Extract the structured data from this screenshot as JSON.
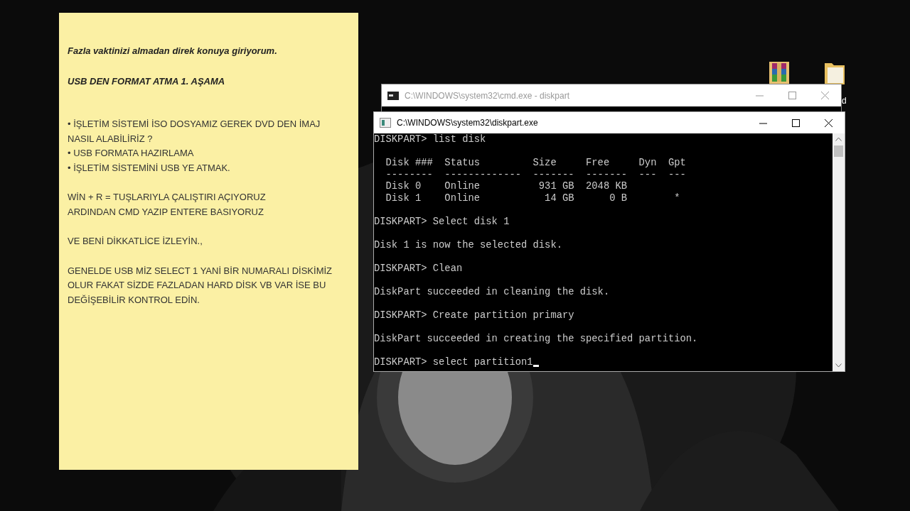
{
  "note": {
    "headings": [
      "Fazla vaktinizi almadan direk konuya giriyorum.",
      "USB DEN FORMAT ATMA 1. AŞAMA"
    ],
    "paragraphs": [
      [
        "• İŞLETİM SİSTEMİ İSO DOSYAMIZ GEREK DVD DEN İMAJ",
        "NASIL ALABİLİRİZ ?",
        "• USB FORMATA HAZIRLAMA",
        "• İŞLETİM SİSTEMİNİ USB YE ATMAK."
      ],
      [
        "WİN + R = TUŞLARIYLA ÇALIŞTIRI AÇIYORUZ",
        "ARDINDAN CMD YAZIP ENTERE BASIYORUZ"
      ],
      [
        "VE BENİ DİKKATLİCE İZLEYİN.,"
      ],
      [
        "GENELDE USB MİZ SELECT 1 YANİ BİR NUMARALI DİSKİMİZ",
        "OLUR FAKAT SİZDE FAZLADAN HARD DİSK VB VAR İSE BU",
        "DEĞİŞEBİLİR KONTROL EDİN."
      ]
    ]
  },
  "desktop_icons": [
    {
      "kind": "archive"
    },
    {
      "kind": "folder",
      "label": "d"
    }
  ],
  "background_window": {
    "title": "C:\\WINDOWS\\system32\\cmd.exe - diskpart",
    "active": false
  },
  "terminal_window": {
    "title": "C:\\WINDOWS\\system32\\diskpart.exe",
    "active": true,
    "cursor": true,
    "blocks": [
      [
        "DISKPART> list disk"
      ],
      [
        "  Disk ###  Status         Size     Free     Dyn  Gpt",
        "  --------  -------------  -------  -------  ---  ---",
        "  Disk 0    Online          931 GB  2048 KB",
        "  Disk 1    Online           14 GB      0 B        *"
      ],
      [
        "DISKPART> Select disk 1"
      ],
      [
        "Disk 1 is now the selected disk."
      ],
      [
        "DISKPART> Clean"
      ],
      [
        "DiskPart succeeded in cleaning the disk."
      ],
      [
        "DISKPART> Create partition primary"
      ],
      [
        "DiskPart succeeded in creating the specified partition."
      ],
      [
        "DISKPART> select partition1"
      ]
    ]
  }
}
